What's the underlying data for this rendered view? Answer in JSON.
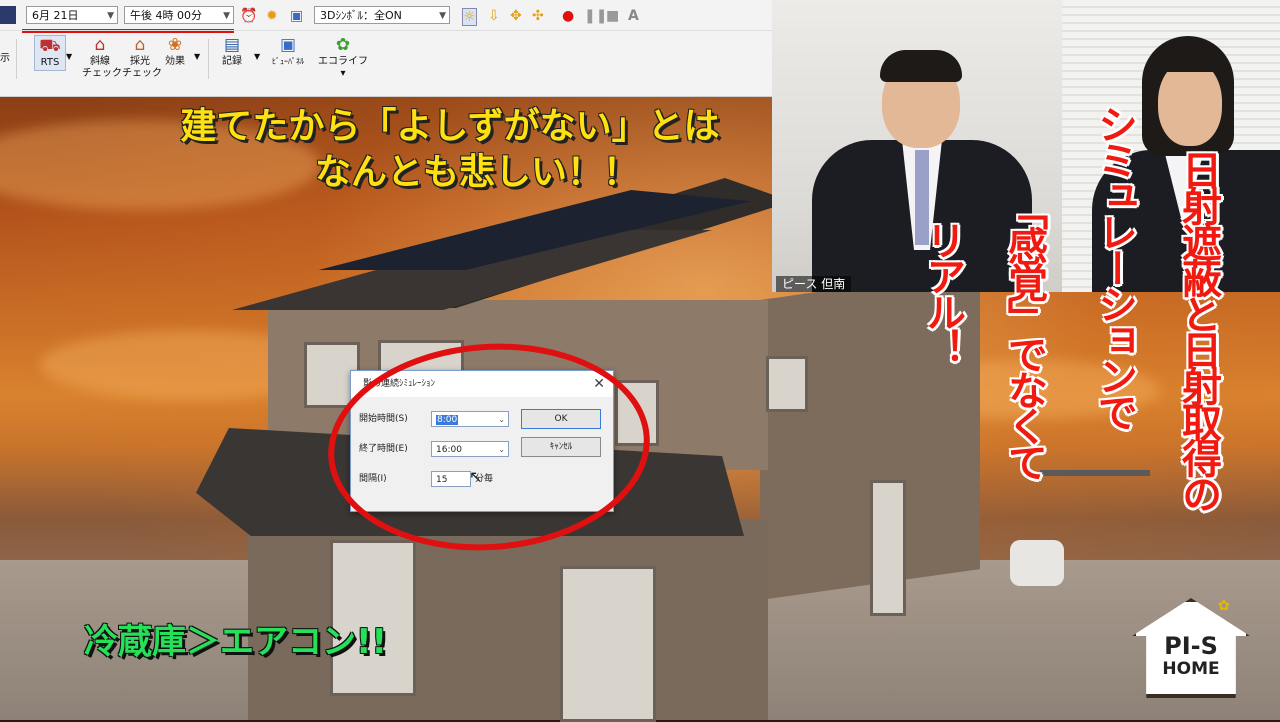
{
  "toolbar": {
    "date_value": "6月 21日",
    "time_value": "午後  4時 00分",
    "symbol_value": "3Dｼﾝﾎﾞﾙ：全ON",
    "clock_icon": "alarm-clock-icon",
    "sun_icon": "sun-icon",
    "text_tool_label": "A",
    "left_partial_label": "示",
    "buttons": [
      {
        "label": "RTS",
        "icon": "rts-icon"
      },
      {
        "label": "斜線\nチェック",
        "icon": "slope-check-icon"
      },
      {
        "label": "採光\nチェック",
        "icon": "daylight-check-icon"
      },
      {
        "label": "効果",
        "icon": "effect-icon"
      },
      {
        "label": "記録",
        "icon": "record-icon"
      },
      {
        "label": "ﾋﾞｭｰﾊﾟﾈﾙ",
        "icon": "view-panel-icon"
      },
      {
        "label": "エコライフ▾",
        "icon": "eco-life-icon"
      }
    ]
  },
  "headline": {
    "line1": "建てたから「よしずがない」とは",
    "line2": "なんとも悲しい！！"
  },
  "green_text": "冷蔵庫＞エアコン!!",
  "webcam": {
    "nameplate": "ピース 但南"
  },
  "vertical_text": {
    "col1": "日射遮蔽と日射取得の",
    "col2": "シミュレーションで",
    "col3": "「感覚」でなくて",
    "col4": "リアル！"
  },
  "dialog": {
    "title": "影の連続ｼﾐｭﾚｰｼｮﾝ",
    "start_label": "開始時間(S)",
    "start_value": "8:00",
    "end_label": "終了時間(E)",
    "end_value": "16:00",
    "interval_label": "間隔(I)",
    "interval_value": "15",
    "interval_unit": "分毎",
    "ok_label": "OK",
    "cancel_label": "ｷｬﾝｾﾙ"
  },
  "logo": {
    "line1": "PI-S",
    "line2": "HOME"
  }
}
